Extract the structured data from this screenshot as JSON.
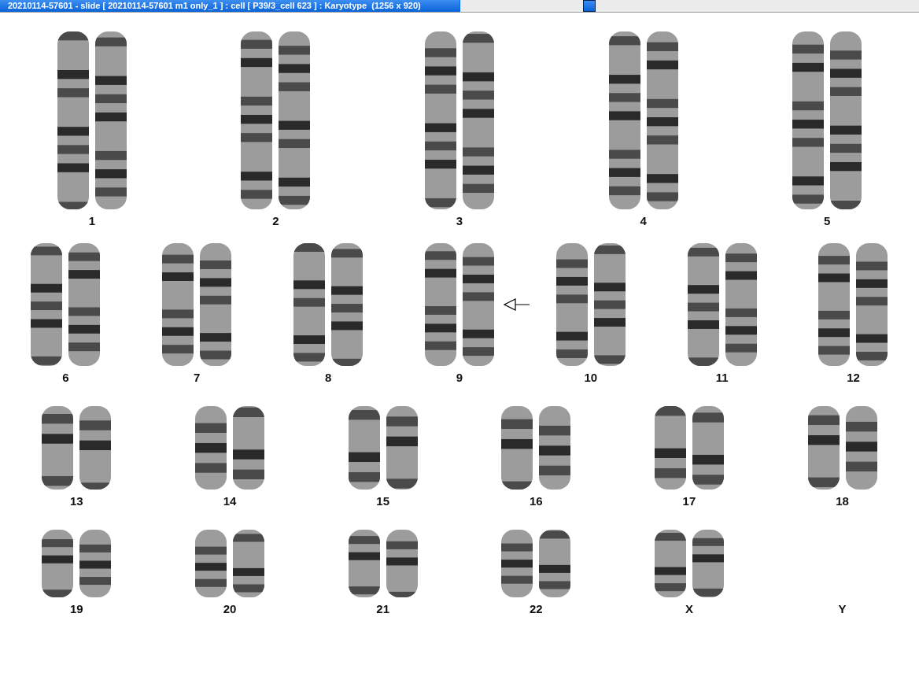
{
  "window": {
    "title": "20210114-57601 - slide [ 20210114-57601 m1 only_1 ] : cell [ P39/3_cell 623 ] : Karyotype  (1256 x 920)"
  },
  "karyotype": {
    "rows": [
      {
        "pairs": [
          {
            "label": "1",
            "kind": "pair",
            "marked": false
          },
          {
            "label": "2",
            "kind": "pair",
            "marked": false
          },
          {
            "label": "3",
            "kind": "pair",
            "marked": false
          },
          {
            "label": "4",
            "kind": "pair",
            "marked": false
          },
          {
            "label": "5",
            "kind": "pair",
            "marked": false
          }
        ]
      },
      {
        "pairs": [
          {
            "label": "6",
            "kind": "pair",
            "marked": false
          },
          {
            "label": "7",
            "kind": "pair",
            "marked": false
          },
          {
            "label": "8",
            "kind": "pair",
            "marked": false
          },
          {
            "label": "9",
            "kind": "pair",
            "marked": true
          },
          {
            "label": "10",
            "kind": "pair",
            "marked": false
          },
          {
            "label": "11",
            "kind": "pair",
            "marked": false
          },
          {
            "label": "12",
            "kind": "pair",
            "marked": false
          }
        ]
      },
      {
        "pairs": [
          {
            "label": "13",
            "kind": "pair",
            "marked": false
          },
          {
            "label": "14",
            "kind": "pair",
            "marked": false
          },
          {
            "label": "15",
            "kind": "pair",
            "marked": false
          },
          {
            "label": "16",
            "kind": "pair",
            "marked": false
          },
          {
            "label": "17",
            "kind": "pair",
            "marked": false
          },
          {
            "label": "18",
            "kind": "pair",
            "marked": false
          }
        ]
      },
      {
        "pairs": [
          {
            "label": "19",
            "kind": "pair",
            "marked": false
          },
          {
            "label": "20",
            "kind": "pair",
            "marked": false
          },
          {
            "label": "21",
            "kind": "pair",
            "marked": false
          },
          {
            "label": "22",
            "kind": "pair",
            "marked": false
          },
          {
            "label": "X",
            "kind": "pair",
            "marked": false
          },
          {
            "label": "Y",
            "kind": "empty",
            "marked": false
          }
        ]
      }
    ]
  }
}
